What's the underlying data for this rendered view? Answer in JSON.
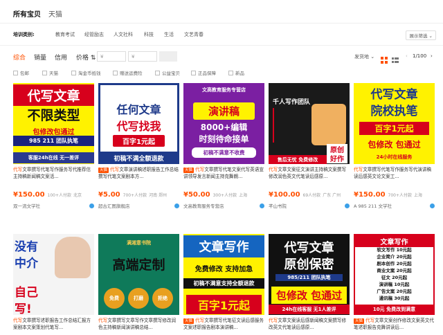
{
  "tabs": {
    "active": "所有宝贝",
    "other": "天猫"
  },
  "categories": {
    "label": "培训类别:",
    "items": [
      "教育考试",
      "经管励志",
      "人文社科",
      "科技",
      "生活",
      "文艺青春"
    ],
    "expand": "展示筛选 ⌄"
  },
  "sort": {
    "items": [
      "综合",
      "销量",
      "信用",
      "价格 ⇅"
    ],
    "price_min": "¥",
    "price_max": "¥",
    "ship": "发货地 ⌄",
    "pager": "1/100",
    "pager_left": "‹",
    "pager_right": "›"
  },
  "filters": [
    "包邮",
    "天猫",
    "淘金币抵钱",
    "赠送运费险",
    "公益宝贝",
    "正品保障",
    "新品"
  ],
  "products": [
    {
      "img_lines": [
        "代写文章",
        "不限类型",
        "包修改包通过",
        "985 211 团队执笔",
        "客服24h在线  无一差评"
      ],
      "title_hl": "代写",
      "title": "文章撰写代笔写作服务写代推荐信主持稿新闻稿文案活...",
      "price": "¥150.00",
      "sold": "100+人付款",
      "loc": "北京",
      "shop": "双一流文学社"
    },
    {
      "img_lines": [
        "任何文章",
        "代写找我",
        "百字1元起",
        "初稿不满全额退款"
      ],
      "badge": "天猫",
      "title_hl": "代写",
      "title": "文章演讲稿述职报告工作总结撰写代笔文案剧本方...",
      "price": "¥5.00",
      "sold": "700+人付款",
      "loc": "河南 郑州",
      "shop": "超古汇图旗舰店"
    },
    {
      "img_lines": [
        "文高教育服务专营店",
        "演讲稿",
        "8000+编辑",
        "时刻待命接单",
        "初稿不满意不收费"
      ],
      "badge": "天猫",
      "title_hl": "代写",
      "title": "文章撰写代笔文案代写英语宣讲领导发言新闻主持克舞朗...",
      "price": "¥50.00",
      "sold": "300+人付款",
      "loc": "上海",
      "shop": "文高教育服务专营店"
    },
    {
      "img_lines": [
        "千人写作团队",
        "原创",
        "好作",
        "售后无忧 免费修改"
      ],
      "title_hl": "代写",
      "title": "文章文案征文演讲主持稿文案撰写修改润色英文代笔读后感原...",
      "price": "¥100.00",
      "sold": "69人付款",
      "loc": "广东 广州",
      "shop": "芊山书院"
    },
    {
      "img_lines": [
        "代写文章",
        "院校执笔",
        "百字1元起",
        "包修改 包通过",
        "24小时在线服务"
      ],
      "title_hl": "代写",
      "title": "文章撰写代笔写作服务写代演讲稿读后感英文论文案工...",
      "price": "¥150.00",
      "sold": "700+人付款",
      "loc": "上海",
      "shop": "A 985 211 文学社"
    },
    {
      "img_lines": [
        "没有",
        "中介",
        "自己",
        "写!"
      ],
      "title_hl": "代写",
      "title": "文章撰写述职报告工作总结汇报方案剧本文案策划代笔写...",
      "price": "",
      "sold": "",
      "loc": "",
      "shop": ""
    },
    {
      "img_lines": [
        "满湘意书院",
        "高端定制",
        "免费",
        "打磨",
        "拒绝"
      ],
      "title_hl": "代写",
      "title": "文章撰写文章写作文章撰写修改润色主持稿新闻演讲稿总结...",
      "price": "",
      "sold": "",
      "loc": "",
      "shop": ""
    },
    {
      "img_lines": [
        "文章写作",
        "免费修改 支持加急",
        "初稿不满意支持全额退款",
        "百字1元起"
      ],
      "badge": "天猫",
      "title_hl": "代写",
      "title": "文章撰写代笔征文读后感服务文案述职报告剧本演讲稿...",
      "price": "",
      "sold": "",
      "loc": "",
      "shop": ""
    },
    {
      "img_lines": [
        "代写文章",
        "原创保密",
        "985/211 团队执笔",
        "包修改 包通过",
        "24h在线客服 无1人差评"
      ],
      "title_hl": "代写",
      "title": "文章文案读后感新闻稿文案撰写修改英文代笔读后感原...",
      "price": "",
      "sold": "",
      "loc": "",
      "shop": ""
    },
    {
      "img_lines": [
        "文章写作",
        "软文写作 10元起",
        "企业简介 20元起",
        "剧本创作 20元起",
        "商业文案 20元起",
        "征文 20元起",
        "演讲稿 10元起",
        "广告文案 20元起",
        "通讯稿 30元起",
        "10元  免费改到满意"
      ],
      "badge": "天猫",
      "title_hl": "代写",
      "title": "文章文案创作修改文案英文代笔述职报告克舞讲读后...",
      "price": "",
      "sold": "",
      "loc": "",
      "shop": ""
    }
  ],
  "colors": {
    "accent": "#ff5000",
    "tmall": "#ff5000"
  }
}
